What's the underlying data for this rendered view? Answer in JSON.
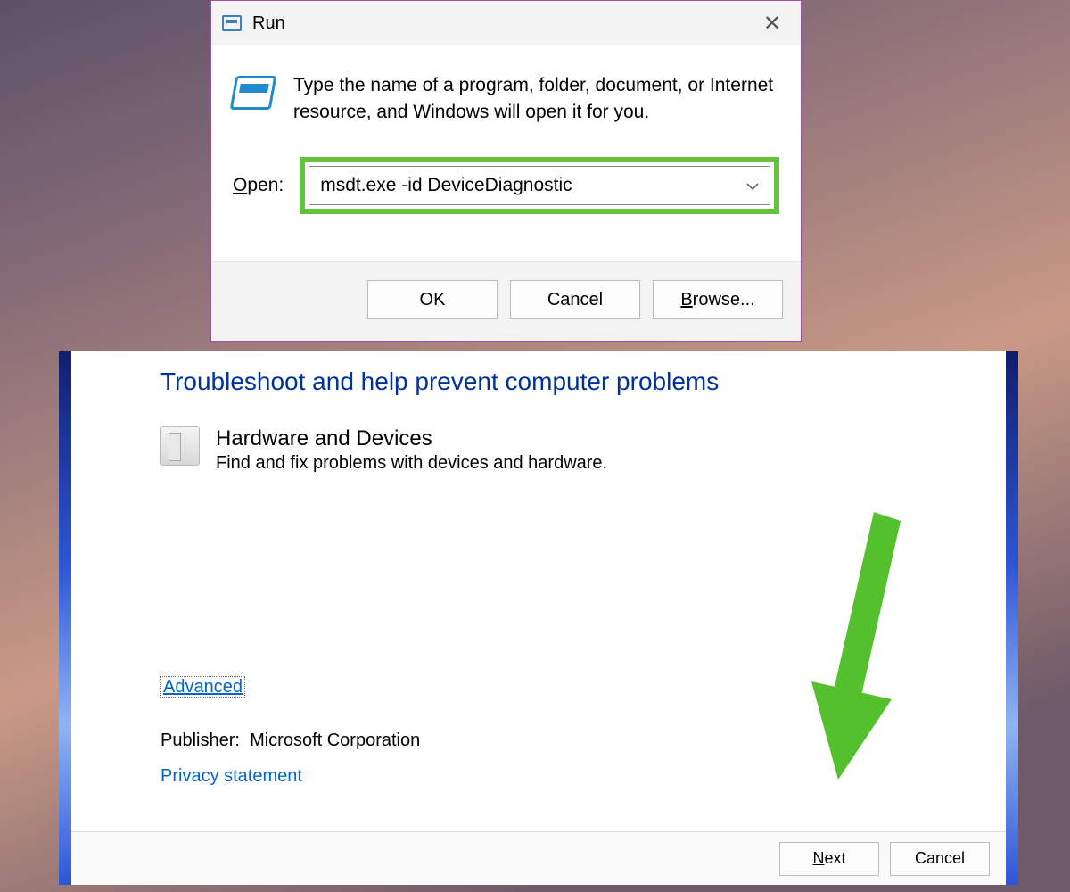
{
  "run": {
    "title": "Run",
    "info": "Type the name of a program, folder, document, or Internet resource, and Windows will open it for you.",
    "open_label_prefix": "O",
    "open_label_rest": "pen:",
    "command": "msdt.exe -id DeviceDiagnostic",
    "ok": "OK",
    "cancel": "Cancel",
    "browse_prefix": "B",
    "browse_rest": "rowse..."
  },
  "ts": {
    "heading": "Troubleshoot and help prevent computer problems",
    "item_title": "Hardware and Devices",
    "item_desc": "Find and fix problems with devices and hardware.",
    "advanced": "Advanced",
    "publisher_label": "Publisher:",
    "publisher_value": "Microsoft Corporation",
    "privacy": "Privacy statement",
    "next_prefix": "N",
    "next_rest": "ext",
    "cancel": "Cancel"
  },
  "annotation": {
    "arrow_color": "#55c02e"
  }
}
